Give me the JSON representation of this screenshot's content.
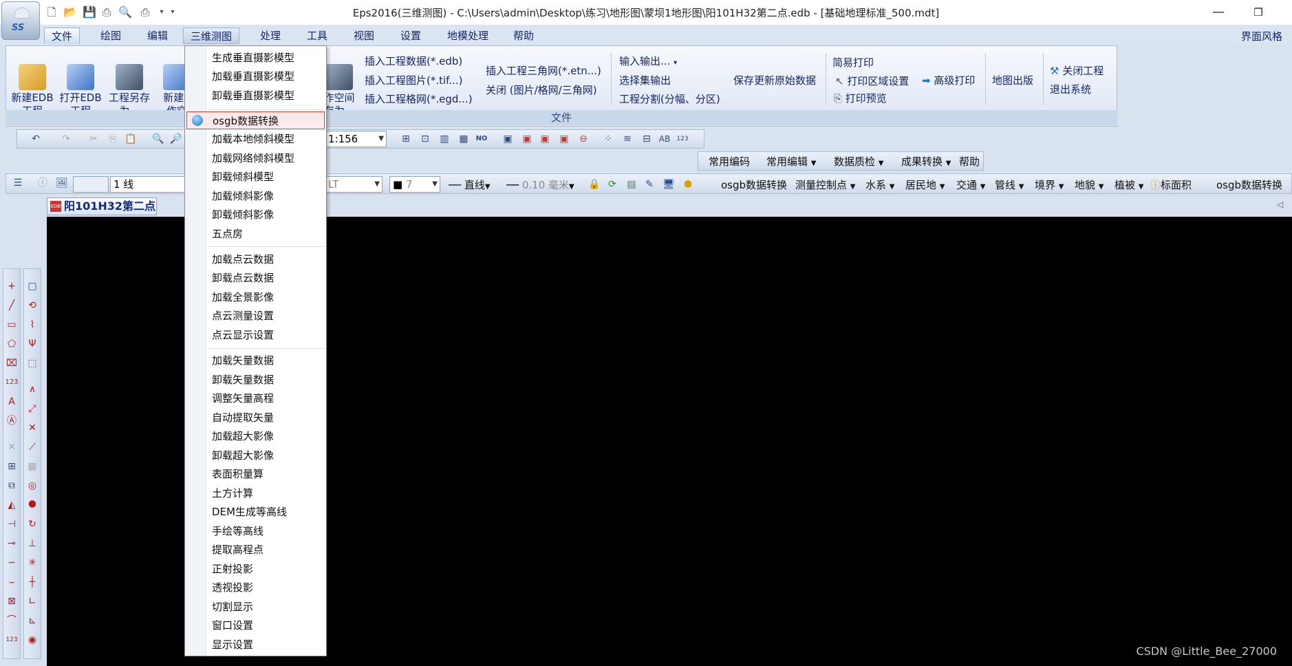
{
  "window": {
    "title": "Eps2016(三维测图) -  C:\\Users\\admin\\Desktop\\练习\\地形图\\蒙坝1地形图\\阳101H32第二点.edb - [基础地理标准_500.mdt]",
    "ui_style": "界面风格"
  },
  "menu": [
    {
      "label": "文件"
    },
    {
      "label": "绘图"
    },
    {
      "label": "编辑"
    },
    {
      "label": "三维测图"
    },
    {
      "label": "处理"
    },
    {
      "label": "工具"
    },
    {
      "label": "视图"
    },
    {
      "label": "设置"
    },
    {
      "label": "地模处理"
    },
    {
      "label": "帮助"
    }
  ],
  "ribbon": {
    "big_buttons": [
      {
        "label": "新建EDB\n工程"
      },
      {
        "label": "打开EDB\n工程"
      },
      {
        "label": "工程另存\n为..."
      },
      {
        "label": "新建E\n作空"
      },
      {
        "label": "作空间\n存为..."
      }
    ],
    "insert_col1": [
      "插入工程数据(*.edb)",
      "插入工程图片(*.tif...)",
      "插入工程格网(*.egd...)"
    ],
    "insert_col2": [
      "插入工程三角网(*.etn...)",
      "关闭 (图片/格网/三角网)"
    ],
    "io_col": [
      "输入输出...",
      "选择集输出",
      "工程分割(分幅、分区)"
    ],
    "save_update": "保存更新原始数据",
    "print_col": [
      "简易打印",
      "打印区域设置",
      "打印预览"
    ],
    "advanced_print": "高级打印",
    "map_publish": "地图出版",
    "system_col": [
      "关闭工程",
      "退出系统"
    ],
    "group_label": "文件"
  },
  "toolbar1": {
    "scale": "1:156"
  },
  "toolbar2": {
    "items": [
      "常用编码",
      "常用编辑",
      "数据质检",
      "成果转换",
      "帮助"
    ]
  },
  "toolbar3": {
    "layer": "1 线",
    "linetype": "LT",
    "color_index": "7",
    "line_style": "直线",
    "line_width": "0.10 毫米",
    "items": [
      "osgb数据转换",
      "测量控制点",
      "水系",
      "居民地",
      "交通",
      "管线",
      "境界",
      "地貌",
      "植被",
      "标面积"
    ],
    "right_item": "osgb数据转换"
  },
  "document_tab": {
    "edb_badge": "EDB",
    "label": "阳101H32第二点"
  },
  "dropdown": {
    "groups": [
      [
        "生成垂直摄影模型",
        "加载垂直摄影模型",
        "卸载垂直摄影模型"
      ],
      [
        "osgb数据转换",
        "加载本地倾斜模型",
        "加载网络倾斜模型",
        "卸载倾斜模型",
        "加载倾斜影像",
        "卸载倾斜影像",
        "五点房"
      ],
      [
        "加载点云数据",
        "卸载点云数据",
        "加载全景影像",
        "点云测量设置",
        "点云显示设置"
      ],
      [
        "加载矢量数据",
        "卸载矢量数据",
        "调整矢量高程",
        "自动提取矢量",
        "加载超大影像",
        "卸载超大影像",
        "表面积量算",
        "土方计算",
        "DEM生成等高线",
        "手绘等高线",
        "提取高程点",
        "正射投影",
        "透视投影",
        "切割显示",
        "窗口设置",
        "显示设置"
      ]
    ]
  },
  "watermark": "CSDN @Little_Bee_27000"
}
